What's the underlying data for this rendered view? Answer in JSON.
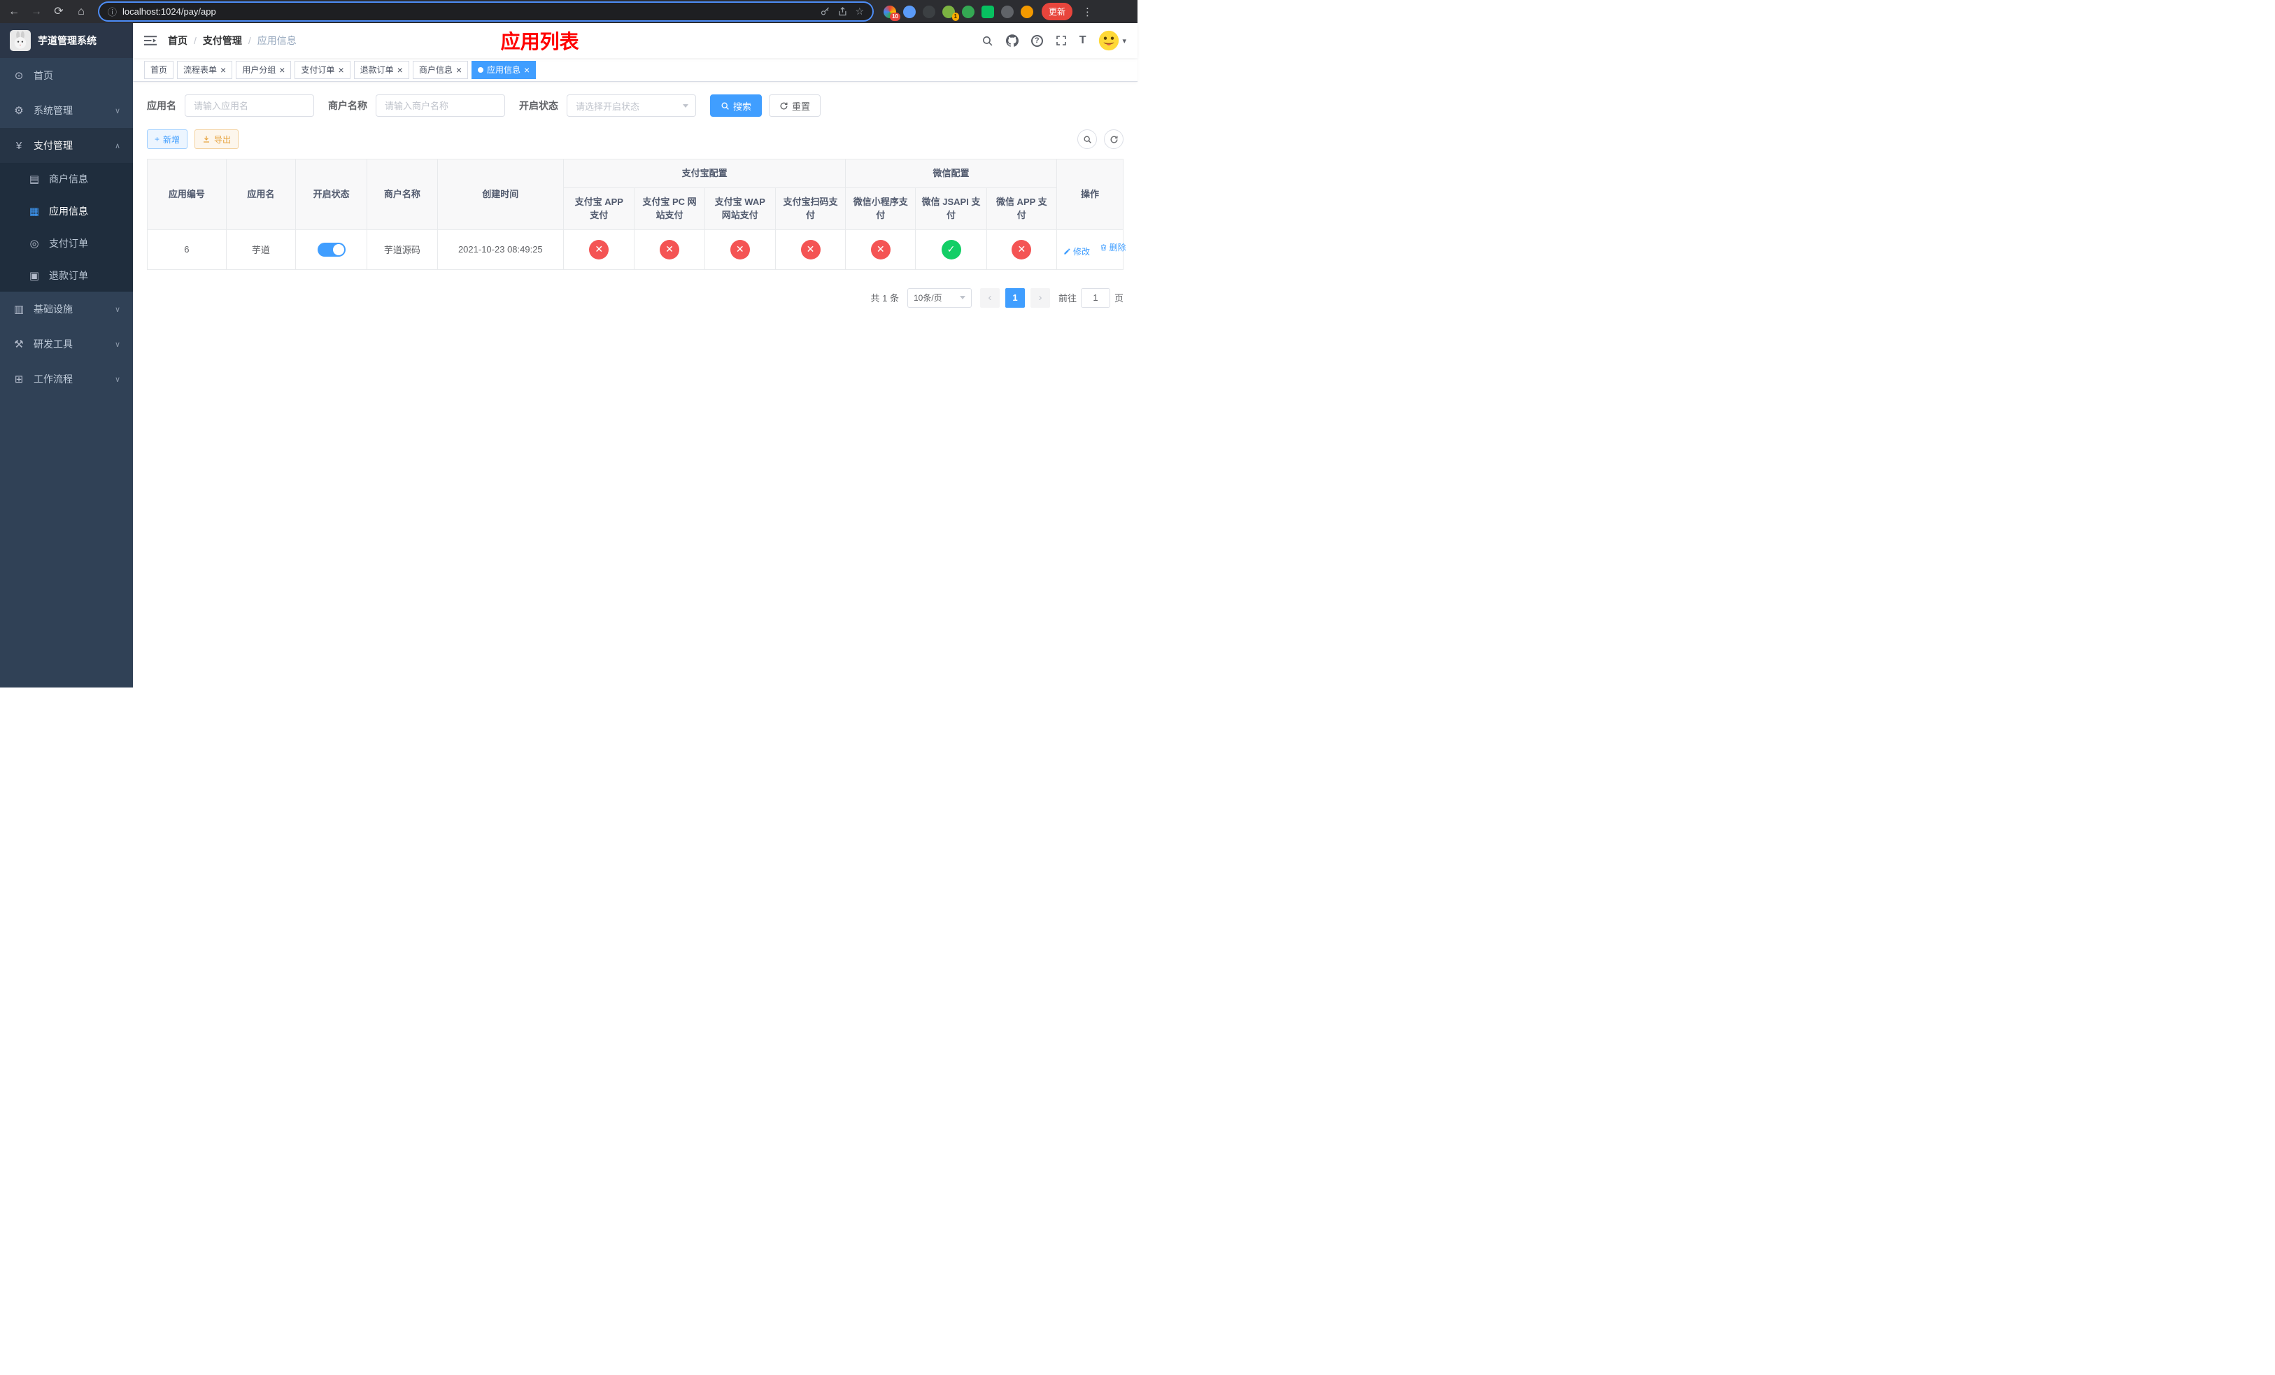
{
  "browser": {
    "url": "localhost:1024/pay/app",
    "update_label": "更新",
    "ext_badge_count": "10",
    "ext_badge_count2": "1"
  },
  "icons": {
    "back": "←",
    "forward": "→",
    "reload": "⟳",
    "home": "⌂",
    "site_info": "ⓘ",
    "bookmark": "☆",
    "menu_dots": "⋮",
    "dashboard": "⊙",
    "gear": "⚙",
    "yen": "¥",
    "merchant": "▤",
    "app_grid": "▦",
    "order": "◎",
    "refund": "▣",
    "infra": "▥",
    "tools": "⚒",
    "workflow": "⊞",
    "chevron_down": "∨",
    "chevron_up": "∧",
    "plus": "+",
    "close": "×",
    "check": "✓",
    "cross": "✕",
    "caret_down": "▾",
    "prev": "‹",
    "next": "›",
    "font_size": "T"
  },
  "sidebar": {
    "logo_title": "芋道管理系统",
    "menu": {
      "home": "首页",
      "system": "系统管理",
      "payment": "支付管理",
      "merchant_info": "商户信息",
      "app_info": "应用信息",
      "pay_order": "支付订单",
      "refund_order": "退款订单",
      "infra": "基础设施",
      "dev_tools": "研发工具",
      "workflow": "工作流程"
    }
  },
  "navbar": {
    "breadcrumb": [
      "首页",
      "支付管理",
      "应用信息"
    ],
    "page_title": "应用列表"
  },
  "tabs": [
    {
      "label": "首页"
    },
    {
      "label": "流程表单"
    },
    {
      "label": "用户分组"
    },
    {
      "label": "支付订单"
    },
    {
      "label": "退款订单"
    },
    {
      "label": "商户信息"
    },
    {
      "label": "应用信息"
    }
  ],
  "filters": {
    "app_name_label": "应用名",
    "app_name_placeholder": "请输入应用名",
    "merchant_label": "商户名称",
    "merchant_placeholder": "请输入商户名称",
    "status_label": "开启状态",
    "status_placeholder": "请选择开启状态",
    "search_button": "搜索",
    "reset_button": "重置"
  },
  "toolbar": {
    "add_button": "新增",
    "export_button": "导出"
  },
  "table": {
    "headers": {
      "app_id": "应用编号",
      "app_name": "应用名",
      "status": "开启状态",
      "merchant_name": "商户名称",
      "create_time": "创建时间",
      "alipay_group": "支付宝配置",
      "wechat_group": "微信配置",
      "alipay_app": "支付宝 APP 支付",
      "alipay_pc": "支付宝 PC 网站支付",
      "alipay_wap": "支付宝 WAP 网站支付",
      "alipay_qr": "支付宝扫码支付",
      "wechat_lite": "微信小程序支付",
      "wechat_jsapi": "微信 JSAPI 支付",
      "wechat_app": "微信 APP 支付",
      "actions": "操作"
    },
    "rows": [
      {
        "app_id": "6",
        "app_name": "芋道",
        "status_on": true,
        "merchant_name": "芋道源码",
        "create_time": "2021-10-23 08:49:25",
        "alipay_app": false,
        "alipay_pc": false,
        "alipay_wap": false,
        "alipay_qr": false,
        "wechat_lite": false,
        "wechat_jsapi": true,
        "wechat_app": false,
        "edit_label": "修改",
        "delete_label": "删除"
      }
    ]
  },
  "pagination": {
    "total_label": "共 1 条",
    "page_size_label": "10条/页",
    "current_page": "1",
    "goto_label": "前往",
    "goto_value": "1",
    "page_unit": "页"
  },
  "colors": {
    "primary": "#409eff",
    "success": "#13ce66",
    "danger": "#f45454",
    "warning": "#e6a23c",
    "title_red": "#ff0000"
  }
}
